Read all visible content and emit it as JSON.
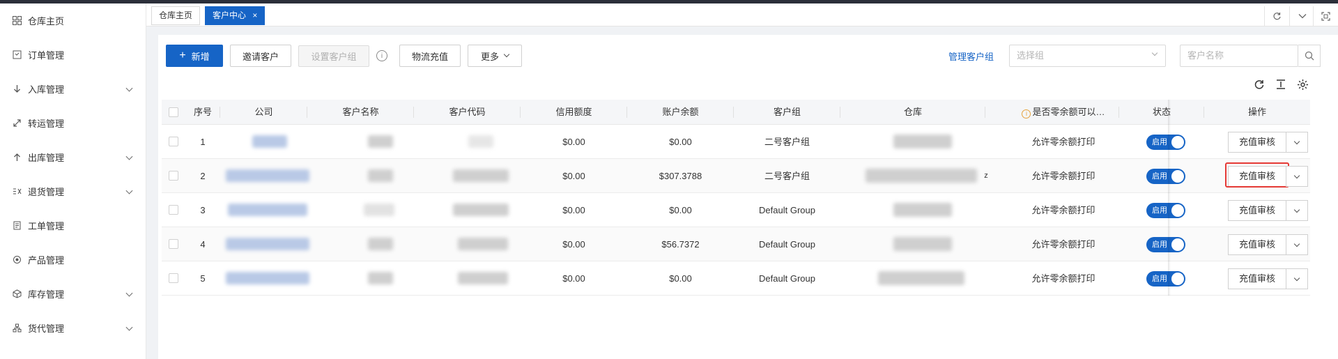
{
  "sidebar": {
    "items": [
      {
        "label": "仓库主页",
        "icon": "grid-icon",
        "expandable": false
      },
      {
        "label": "订单管理",
        "icon": "order-icon",
        "expandable": false
      },
      {
        "label": "入库管理",
        "icon": "arrow-down-icon",
        "expandable": true
      },
      {
        "label": "转运管理",
        "icon": "transfer-icon",
        "expandable": false
      },
      {
        "label": "出库管理",
        "icon": "arrow-up-icon",
        "expandable": true
      },
      {
        "label": "退货管理",
        "icon": "return-icon",
        "expandable": true
      },
      {
        "label": "工单管理",
        "icon": "ticket-icon",
        "expandable": false
      },
      {
        "label": "产品管理",
        "icon": "product-icon",
        "expandable": false
      },
      {
        "label": "库存管理",
        "icon": "inventory-icon",
        "expandable": true
      },
      {
        "label": "货代管理",
        "icon": "forwarder-icon",
        "expandable": true
      }
    ]
  },
  "tabs": [
    {
      "label": "仓库主页",
      "active": false
    },
    {
      "label": "客户中心",
      "active": true,
      "close": "×"
    }
  ],
  "toolbar": {
    "new_label": "新增",
    "new_icon": "+",
    "invite_label": "邀请客户",
    "set_group_label": "设置客户组",
    "info_icon": "i",
    "recharge_label": "物流充值",
    "more_label": "更多",
    "manage_group_link": "管理客户组",
    "group_select_placeholder": "选择组",
    "customer_name_placeholder": "客户名称"
  },
  "table": {
    "headers": {
      "index": "序号",
      "company": "公司",
      "customer_name": "客户名称",
      "customer_code": "客户代码",
      "credit": "信用额度",
      "balance": "账户余额",
      "group": "客户组",
      "warehouse": "仓库",
      "zero_balance": "是否零余额可以…",
      "status": "状态",
      "action": "操作"
    },
    "rows": [
      {
        "index": "1",
        "credit": "$0.00",
        "balance": "$0.00",
        "group": "二号客户组",
        "zero_balance": "允许零余额打印",
        "status": "启用",
        "action": "充值审核",
        "extra": ""
      },
      {
        "index": "2",
        "credit": "$0.00",
        "balance": "$307.3788",
        "group": "二号客户组",
        "zero_balance": "允许零余额打印",
        "status": "启用",
        "action": "充值审核",
        "extra": "z"
      },
      {
        "index": "3",
        "credit": "$0.00",
        "balance": "$0.00",
        "group": "Default Group",
        "zero_balance": "允许零余额打印",
        "status": "启用",
        "action": "充值审核",
        "extra": ""
      },
      {
        "index": "4",
        "credit": "$0.00",
        "balance": "$56.7372",
        "group": "Default Group",
        "zero_balance": "允许零余额打印",
        "status": "启用",
        "action": "充值审核",
        "extra": ""
      },
      {
        "index": "5",
        "credit": "$0.00",
        "balance": "$0.00",
        "group": "Default Group",
        "zero_balance": "允许零余额打印",
        "status": "启用",
        "action": "充值审核",
        "extra": ""
      }
    ]
  },
  "colors": {
    "primary": "#1664c6",
    "highlight": "#e53935",
    "warning": "#e6a23c"
  }
}
